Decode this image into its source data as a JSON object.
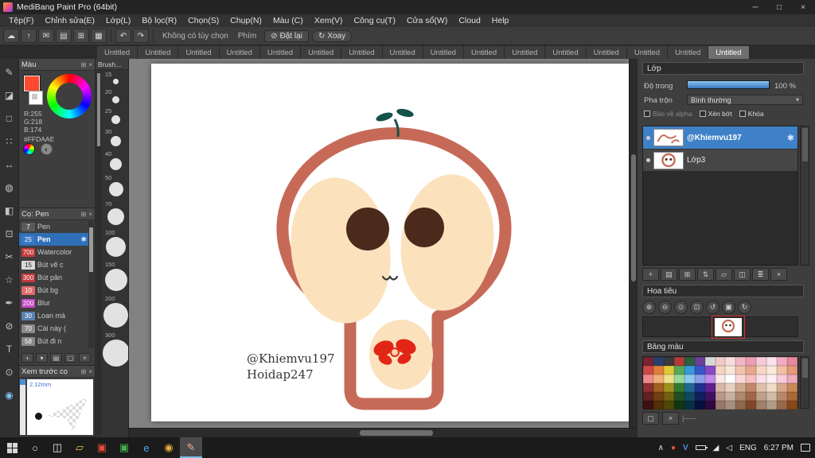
{
  "window": {
    "title": "MediBang Paint Pro (64bit)",
    "controls": {
      "min": "─",
      "max": "□",
      "close": "×"
    }
  },
  "icons": {
    "popout": "⊞",
    "close": "×",
    "dropdown_arrow": "▾",
    "gear": "✱"
  },
  "menubar": {
    "items": [
      {
        "label": "Tệp(F)"
      },
      {
        "label": "Chỉnh sửa(E)"
      },
      {
        "label": "Lớp(L)"
      },
      {
        "label": "Bộ lọc(R)"
      },
      {
        "label": "Chọn(S)"
      },
      {
        "label": "Chụp(N)"
      },
      {
        "label": "Màu (C)"
      },
      {
        "label": "Xem(V)"
      },
      {
        "label": "Công cụ(T)"
      },
      {
        "label": "Cửa sổ(W)"
      },
      {
        "label": "Cloud"
      },
      {
        "label": "Help"
      }
    ]
  },
  "toolbar": {
    "left_icons": [
      {
        "name": "cloud-icon",
        "glyph": "☁"
      },
      {
        "name": "upload-icon",
        "glyph": "↑"
      },
      {
        "name": "comment-icon",
        "glyph": "✉"
      },
      {
        "name": "note-icon",
        "glyph": "▤"
      },
      {
        "name": "grid-icon",
        "glyph": "⊞"
      },
      {
        "name": "layout-icon",
        "glyph": "▦"
      }
    ],
    "undo_glyph": "↶",
    "redo_glyph": "↷",
    "no_option_text": "Không có tùy chọn",
    "keys_label": "Phím",
    "reset_icon": "⊘",
    "reset_label": "Đặt lại",
    "rotate_icon": "↻",
    "rotate_label": "Xoay"
  },
  "tabs": {
    "items": [
      {
        "label": "Untitled"
      },
      {
        "label": "Untitled"
      },
      {
        "label": "Untitled"
      },
      {
        "label": "Untitled"
      },
      {
        "label": "Untitled"
      },
      {
        "label": "Untitled"
      },
      {
        "label": "Untitled"
      },
      {
        "label": "Untitled"
      },
      {
        "label": "Untitled"
      },
      {
        "label": "Untitled"
      },
      {
        "label": "Untitled"
      },
      {
        "label": "Untitled"
      },
      {
        "label": "Untitled"
      },
      {
        "label": "Untitled"
      },
      {
        "label": "Untitled"
      },
      {
        "label": "Untitled",
        "active": true
      }
    ]
  },
  "tools": [
    {
      "name": "brush-tool",
      "glyph": "✎"
    },
    {
      "name": "eraser-tool",
      "glyph": "◪"
    },
    {
      "name": "select-rect-tool",
      "glyph": "□"
    },
    {
      "name": "dot-tool",
      "glyph": "∷"
    },
    {
      "name": "move-tool",
      "glyph": "↔"
    },
    {
      "name": "fill-tool",
      "glyph": "◍"
    },
    {
      "name": "gradient-tool",
      "glyph": "◧"
    },
    {
      "name": "select-tool",
      "glyph": "⊡"
    },
    {
      "name": "lasso-tool",
      "glyph": "✂"
    },
    {
      "name": "magic-wand-tool",
      "glyph": "☆"
    },
    {
      "name": "select-pen-tool",
      "glyph": "✒"
    },
    {
      "name": "select-eraser-tool",
      "glyph": "⊘"
    },
    {
      "name": "text-tool",
      "glyph": "T"
    },
    {
      "name": "eyedropper-tool",
      "glyph": "⊙"
    },
    {
      "name": "hand-tool",
      "glyph": "◉",
      "active": true
    }
  ],
  "color_panel": {
    "title": "Màu",
    "r_label": "R:255",
    "g_label": "G:218",
    "b_label": "B:174",
    "hex_label": "#FFDAAE",
    "foreground_color": "#ff4a30",
    "background_color": "#ffffff"
  },
  "brush_sizes": {
    "title": "Brush...",
    "items": [
      {
        "label": "15",
        "d": 7
      },
      {
        "label": "20",
        "d": 9
      },
      {
        "label": "25",
        "d": 11
      },
      {
        "label": "30",
        "d": 13
      },
      {
        "label": "40",
        "d": 15
      },
      {
        "label": "50",
        "d": 18
      },
      {
        "label": "70",
        "d": 21
      },
      {
        "label": "100",
        "d": 25
      },
      {
        "label": "150",
        "d": 28
      },
      {
        "label": "200",
        "d": 31
      },
      {
        "label": "300",
        "d": 34
      }
    ]
  },
  "brush_panel": {
    "title": "Cọ: Pen",
    "items": [
      {
        "size": "7",
        "name": "Pen",
        "chip": "#5a5a5a"
      },
      {
        "size": "25",
        "name": "Pen",
        "chip": "#3a78c2",
        "selected": true,
        "gear": "✱"
      },
      {
        "size": "700",
        "name": "Watercolor",
        "chip": "#c43a3a"
      },
      {
        "size": "15",
        "name": "Bút vẽ c",
        "chip": "#d8d8d8",
        "fg": "#222222"
      },
      {
        "size": "300",
        "name": "Bút pân",
        "chip": "#c43a3a"
      },
      {
        "size": "10",
        "name": "Bút bg",
        "chip": "#e06a6a"
      },
      {
        "size": "200",
        "name": "Blur",
        "chip": "#c44ac4"
      },
      {
        "size": "30",
        "name": "Loan mà",
        "chip": "#5a82b4"
      },
      {
        "size": "70",
        "name": "Cài này (",
        "chip": "#8a8a8a"
      },
      {
        "size": "58",
        "name": "Bút đi n",
        "chip": "#8a8a8a"
      }
    ],
    "buttons": [
      {
        "name": "add-brush-button",
        "glyph": "+"
      },
      {
        "name": "brush-menu-button",
        "glyph": "▾"
      },
      {
        "name": "brush-settings-button",
        "glyph": "▤"
      },
      {
        "name": "duplicate-brush-button",
        "glyph": "▢"
      },
      {
        "name": "delete-brush-button",
        "glyph": "×"
      }
    ]
  },
  "preview_panel": {
    "title": "Xem trước cọ",
    "size_label": "2.12mm"
  },
  "canvas": {
    "credit_line1": "@Khiemvu197",
    "credit_line2": "Hoidap247",
    "colors": {
      "outline": "#c66a57",
      "cheek": "#fbe2bd",
      "eye": "#4b2a1c",
      "sprout": "#14524a",
      "bow": "#e22616",
      "bow_center": "#f6d7a6",
      "text": "#373737"
    }
  },
  "layer_panel": {
    "title": "Lớp",
    "opacity_label": "Độ trong",
    "opacity_value": "100 %",
    "blend_label": "Pha trộn",
    "blend_value": "Bình thường",
    "checkboxes": [
      {
        "label": "Bảo vệ alpha",
        "dim": true
      },
      {
        "label": "Xén bớt"
      },
      {
        "label": "Khóa"
      }
    ],
    "layers": [
      {
        "name": "@Khiemvu197",
        "selected": true
      },
      {
        "name": "Lớp3"
      }
    ],
    "buttons": [
      {
        "name": "new-layer-button",
        "glyph": "+"
      },
      {
        "name": "new-folder-button",
        "glyph": "▤"
      },
      {
        "name": "duplicate-layer-button",
        "glyph": "⊞"
      },
      {
        "name": "transfer-layer-button",
        "glyph": "⇅"
      },
      {
        "name": "folder-layer-button",
        "glyph": "▱"
      },
      {
        "name": "merge-layer-button",
        "glyph": "◫"
      },
      {
        "name": "flatten-layer-button",
        "glyph": "≣"
      },
      {
        "name": "delete-layer-button",
        "glyph": "×"
      }
    ]
  },
  "navigator": {
    "title": "Hoa tiêu",
    "buttons": [
      {
        "name": "zoom-in-button",
        "glyph": "⊕"
      },
      {
        "name": "zoom-out-button",
        "glyph": "⊖"
      },
      {
        "name": "zoom-reset-button",
        "glyph": "⊙"
      },
      {
        "name": "fit-button",
        "glyph": "⊡"
      },
      {
        "name": "rotate-left-button",
        "glyph": "↺"
      },
      {
        "name": "fit-screen-button",
        "glyph": "▣"
      },
      {
        "name": "rotate-right-button",
        "glyph": "↻"
      }
    ]
  },
  "palette": {
    "title": "Bảng màu",
    "ruler_label": "|-----",
    "colors": [
      "#7a2430",
      "#28406e",
      "#3a3a3a",
      "#b43a3a",
      "#2e6040",
      "#6a4098",
      "#d8d8d8",
      "#f2c8c8",
      "#f7dede",
      "#f1b8c4",
      "#ea9fb4",
      "#f5ccd8",
      "#fbe2ec",
      "#f2adc2",
      "#e6889e",
      "#d04848",
      "#e08038",
      "#e0c838",
      "#58a858",
      "#3898d8",
      "#3858c8",
      "#8848c8",
      "#f4d6c2",
      "#f8e6d8",
      "#f1c4ae",
      "#e9a88e",
      "#f5d8c6",
      "#fae9dc",
      "#f2c0a4",
      "#e69a78",
      "#f08a8a",
      "#f0b078",
      "#efe08a",
      "#98d898",
      "#8ac8ee",
      "#8aa0e8",
      "#c08ae8",
      "#fbe8e8",
      "#ffffff",
      "#fbd8d8",
      "#f7c0c0",
      "#fbe0e8",
      "#fff0f4",
      "#f7ccd8",
      "#efaabc",
      "#8e3030",
      "#a06020",
      "#a09020",
      "#307830",
      "#206890",
      "#203090",
      "#602090",
      "#d8b8a8",
      "#e8d0c0",
      "#d0a890",
      "#c08868",
      "#e0c0a8",
      "#f0dcc8",
      "#d8a888",
      "#c88858",
      "#602020",
      "#704010",
      "#706010",
      "#205020",
      "#104860",
      "#102060",
      "#401060",
      "#b89888",
      "#c8b0a0",
      "#b08870",
      "#a06848",
      "#c0a088",
      "#d0bca8",
      "#b88868",
      "#a86838",
      "#401010",
      "#503008",
      "#504808",
      "#103810",
      "#083040",
      "#081040",
      "#300840",
      "#987868",
      "#a89080",
      "#906850",
      "#804828",
      "#a08068",
      "#b09c88",
      "#986848",
      "#884818"
    ]
  },
  "taskbar": {
    "apps": [
      {
        "name": "search-button",
        "glyph": "○",
        "color": "#e8e8e8"
      },
      {
        "name": "task-view-button",
        "glyph": "◫",
        "color": "#e8e8e8"
      },
      {
        "name": "file-explorer-button",
        "glyph": "▱",
        "color": "#f2c14e"
      },
      {
        "name": "app-red-button",
        "glyph": "▣",
        "color": "#e24b3a"
      },
      {
        "name": "app-green-button",
        "glyph": "▣",
        "color": "#43b049"
      },
      {
        "name": "edge-browser-button",
        "glyph": "e",
        "color": "#4aa8e8"
      },
      {
        "name": "chrome-browser-button",
        "glyph": "◉",
        "color": "#e8b23a"
      },
      {
        "name": "medibang-paint-button",
        "glyph": "✎",
        "color": "#f2a088",
        "active": true
      }
    ],
    "tray": {
      "chevron_glyph": "∧",
      "app_glyph": "●",
      "app_color": "#e05a32",
      "shield_glyph": "V",
      "shield_color": "#4a90e0",
      "network_glyph": "◢",
      "speaker_glyph": "◁",
      "lang": "ENG",
      "time": "6:27 PM"
    }
  }
}
